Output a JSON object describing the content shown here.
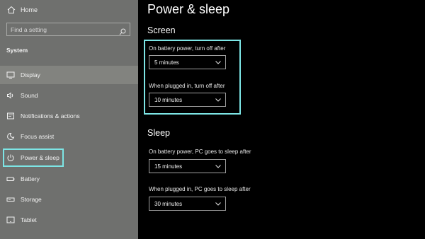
{
  "sidebar": {
    "home_label": "Home",
    "search_placeholder": "Find a setting",
    "section_title": "System",
    "items": [
      {
        "label": "Display",
        "icon": "display-icon"
      },
      {
        "label": "Sound",
        "icon": "speaker-icon"
      },
      {
        "label": "Notifications & actions",
        "icon": "notification-icon"
      },
      {
        "label": "Focus assist",
        "icon": "moon-icon"
      },
      {
        "label": "Power & sleep",
        "icon": "power-icon"
      },
      {
        "label": "Battery",
        "icon": "battery-icon"
      },
      {
        "label": "Storage",
        "icon": "storage-icon"
      },
      {
        "label": "Tablet",
        "icon": "tablet-icon"
      }
    ]
  },
  "main": {
    "title": "Power & sleep",
    "screen": {
      "title": "Screen",
      "battery_label": "On battery power, turn off after",
      "battery_value": "5 minutes",
      "plugged_label": "When plugged in, turn off after",
      "plugged_value": "10 minutes"
    },
    "sleep": {
      "title": "Sleep",
      "battery_label": "On battery power, PC goes to sleep after",
      "battery_value": "15 minutes",
      "plugged_label": "When plugged in, PC goes to sleep after",
      "plugged_value": "30 minutes"
    }
  },
  "colors": {
    "sidebar_bg": "#6f706e",
    "highlight": "#7de5e5",
    "main_bg": "#000000"
  }
}
